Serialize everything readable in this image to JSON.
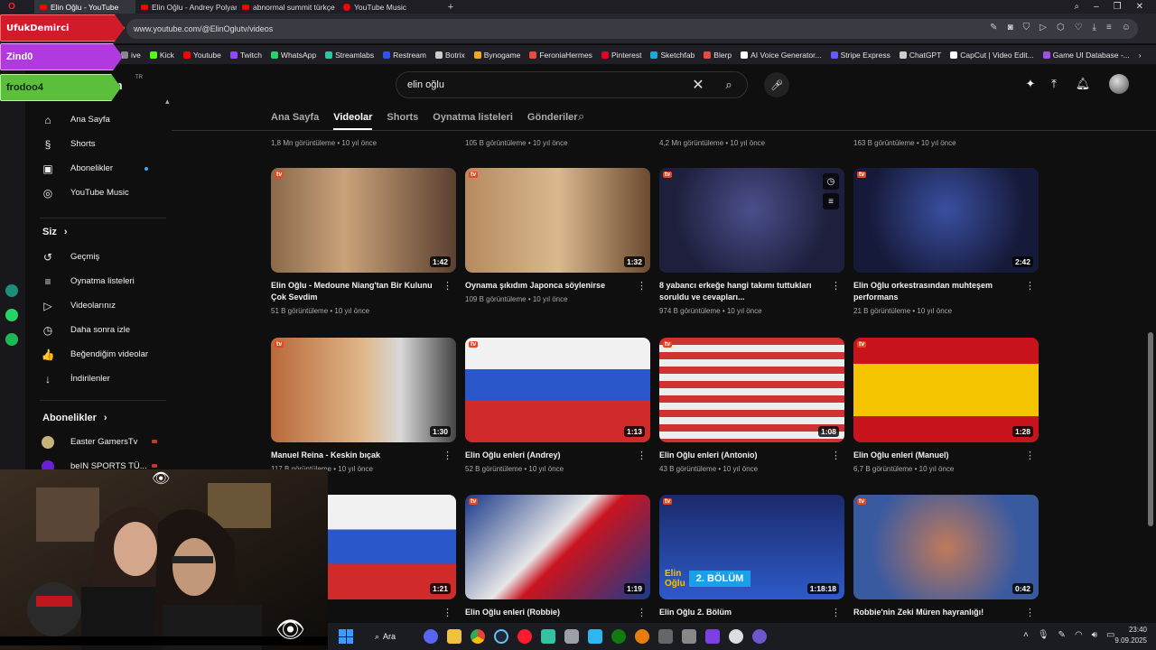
{
  "browser": {
    "tabs": [
      {
        "label": "Elin Oğlu - YouTube",
        "active": true,
        "kind": "yt"
      },
      {
        "label": "Elin Oğlu - Andrey Polyan",
        "active": false,
        "kind": "yt"
      },
      {
        "label": "abnormal summit türkçe",
        "active": false,
        "kind": "yt"
      },
      {
        "label": "YouTube Music",
        "active": false,
        "kind": "music"
      }
    ],
    "new_tab": "+",
    "url": "www.youtube.com/@ElinOglutv/videos",
    "bookmarks": [
      {
        "label": "ive",
        "color": "#888888"
      },
      {
        "label": "Kick",
        "color": "#53fc18"
      },
      {
        "label": "Youtube",
        "color": "#ff0000"
      },
      {
        "label": "Twitch",
        "color": "#9146ff"
      },
      {
        "label": "WhatsApp",
        "color": "#25d366"
      },
      {
        "label": "Streamlabs",
        "color": "#31c3a2"
      },
      {
        "label": "Restream",
        "color": "#2f54eb"
      },
      {
        "label": "Botrix",
        "color": "#cccccc"
      },
      {
        "label": "Bynogame",
        "color": "#f5a623"
      },
      {
        "label": "FeroniaHermes",
        "color": "#e74c3c"
      },
      {
        "label": "Pinterest",
        "color": "#e60023"
      },
      {
        "label": "Sketchfab",
        "color": "#1caad9"
      },
      {
        "label": "Blerp",
        "color": "#e84b3c"
      },
      {
        "label": "AI Voice Generator...",
        "color": "#ffffff"
      },
      {
        "label": "Stripe Express",
        "color": "#635bff"
      },
      {
        "label": "ChatGPT",
        "color": "#cccccc"
      },
      {
        "label": "CapCut | Video Edit...",
        "color": "#ffffff"
      },
      {
        "label": "Game UI Database -...",
        "color": "#a050e0"
      }
    ]
  },
  "overlays": {
    "alert1": "UfukDemirci",
    "alert2": "Zind0",
    "alert3": "frodoo4",
    "logo_fragment": "um",
    "logo_tr": "TR"
  },
  "search": {
    "query": "elin oğlu"
  },
  "channel_tabs": [
    "Ana Sayfa",
    "Videolar",
    "Shorts",
    "Oynatma listeleri",
    "Gönderiler"
  ],
  "sidebar": {
    "main": [
      {
        "label": "Ana Sayfa",
        "icon": "home-icon",
        "glyph": "⌂"
      },
      {
        "label": "Shorts",
        "icon": "shorts-icon",
        "glyph": "§"
      },
      {
        "label": "Abonelikler",
        "icon": "subscriptions-icon",
        "glyph": "▣"
      },
      {
        "label": "YouTube Music",
        "icon": "music-icon",
        "glyph": "◎"
      }
    ],
    "you_heading": "Siz",
    "you": [
      {
        "label": "Geçmiş",
        "icon": "history-icon",
        "glyph": "↺"
      },
      {
        "label": "Oynatma listeleri",
        "icon": "playlist-icon",
        "glyph": "≡"
      },
      {
        "label": "Videolarınız",
        "icon": "your-videos-icon",
        "glyph": "▷"
      },
      {
        "label": "Daha sonra izle",
        "icon": "watch-later-icon",
        "glyph": "◷"
      },
      {
        "label": "Beğendiğim videolar",
        "icon": "like-icon",
        "glyph": "👍"
      },
      {
        "label": "İndirilenler",
        "icon": "download-icon",
        "glyph": "↓"
      }
    ],
    "subs_heading": "Abonelikler",
    "subs": [
      {
        "label": "Easter GamersTv"
      },
      {
        "label": "beIN SPORTS TÜ..."
      }
    ]
  },
  "prev_row_meta": [
    "1,8 Mn görüntüleme • 10 yıl önce",
    "105 B görüntüleme • 10 yıl önce",
    "4,2 Mn görüntüleme • 10 yıl önce",
    "163 B görüntüleme • 10 yıl önce"
  ],
  "videos": [
    {
      "title": "Elin Oğlu - Medoune Niang'tan Bir Kulunu Çok Sevdim",
      "meta": "51 B görüntüleme • 10 yıl önce",
      "duration": "1:42"
    },
    {
      "title": "Oynama şıkıdım Japonca söylenirse",
      "meta": "109 B görüntüleme • 10 yıl önce",
      "duration": "1:32"
    },
    {
      "title": "8 yabancı erkeğe hangi takımı tuttukları soruldu ve cevapları...",
      "meta": "974 B görüntüleme • 10 yıl önce",
      "duration": ""
    },
    {
      "title": "Elin Oğlu orkestrasından muhteşem performans",
      "meta": "21 B görüntüleme • 10 yıl önce",
      "duration": "2:42"
    },
    {
      "title": "Manuel Reina - Keskin bıçak",
      "meta": "117 B görüntüleme • 10 yıl önce",
      "duration": "1:30"
    },
    {
      "title": "Elin Oğlu enleri (Andrey)",
      "meta": "52 B görüntüleme • 10 yıl önce",
      "duration": "1:13"
    },
    {
      "title": "Elin Oğlu enleri (Antonio)",
      "meta": "43 B görüntüleme • 10 yıl önce",
      "duration": "1:08"
    },
    {
      "title": "Elin Oğlu enleri (Manuel)",
      "meta": "6,7 B görüntüleme • 10 yıl önce",
      "duration": "1:28"
    },
    {
      "title": "(Emrach)",
      "meta": "",
      "duration": "1:21"
    },
    {
      "title": "Elin Oğlu enleri (Robbie)",
      "meta": "",
      "duration": "1:19"
    },
    {
      "title": "Elin Oğlu 2. Bölüm",
      "meta": "",
      "duration": "1:18:18"
    },
    {
      "title": "Robbie'nin Zeki Müren hayranlığı!",
      "meta": "",
      "duration": "0:42"
    }
  ],
  "thumb_badge": "tv",
  "episode_banner": {
    "line1": "Elin",
    "line2": "Oğlu",
    "badge": "2. BÖLÜM"
  },
  "taskbar": {
    "search": "Ara",
    "time": "23:40",
    "date": "9.09.2025"
  },
  "colors": {
    "yt_red": "#ff0000",
    "accent_blue": "#3ea6ff",
    "bg": "#0f0f0f"
  }
}
